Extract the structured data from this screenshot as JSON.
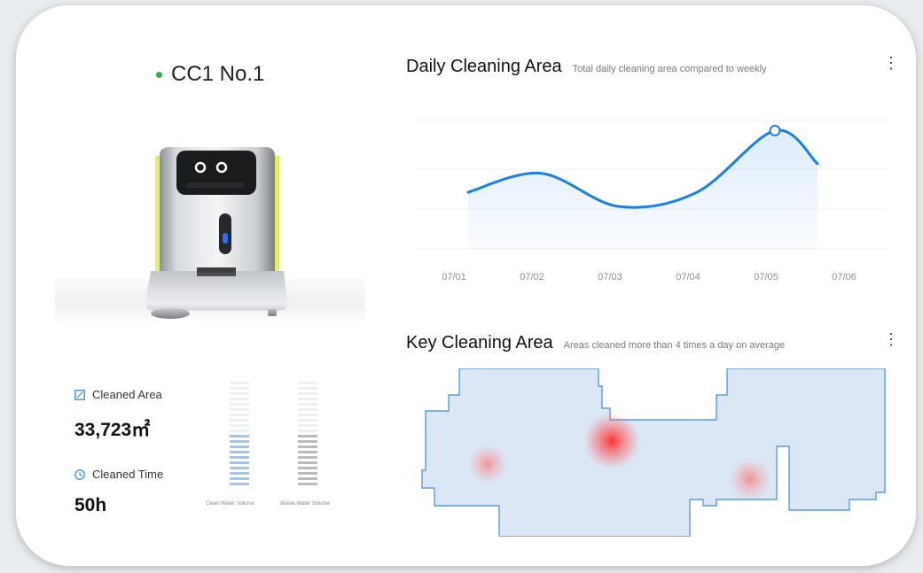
{
  "device": {
    "name": "CC1 No.1",
    "status_color": "#2bb24c"
  },
  "stats": {
    "area_label": "Cleaned Area",
    "area_value": "33,723㎡",
    "time_label": "Cleaned Time",
    "time_value": "50h",
    "icon_color": "#3d8fe0"
  },
  "gauges": {
    "clean_label": "Clean Water Volume",
    "clean_level": 0.5,
    "clean_color": "#9dc6ef",
    "waste_label": "Waste Water Volume",
    "waste_level": 0.5,
    "waste_color": "#b7bcc4"
  },
  "daily": {
    "title": "Daily Cleaning Area",
    "subtitle": "Total daily cleaning area compared to weekly",
    "more_icon": "more-vertical-icon"
  },
  "chart_data": {
    "type": "area",
    "categories": [
      "07/01",
      "07/02",
      "07/03",
      "07/04",
      "07/05",
      "07/06"
    ],
    "values": [
      55,
      75,
      40,
      55,
      120,
      85
    ],
    "ylim": [
      0,
      140
    ],
    "highlight_index": 4,
    "line_color": "#1a7fe8",
    "grid": true
  },
  "key_area": {
    "title": "Key Cleaning Area",
    "subtitle": "Areas cleaned more than 4 times a day on average",
    "more_icon": "more-vertical-icon",
    "map_fill": "#dbe7f4",
    "map_stroke": "#5b9be0",
    "hotspot_color": "#ff2a2a"
  }
}
